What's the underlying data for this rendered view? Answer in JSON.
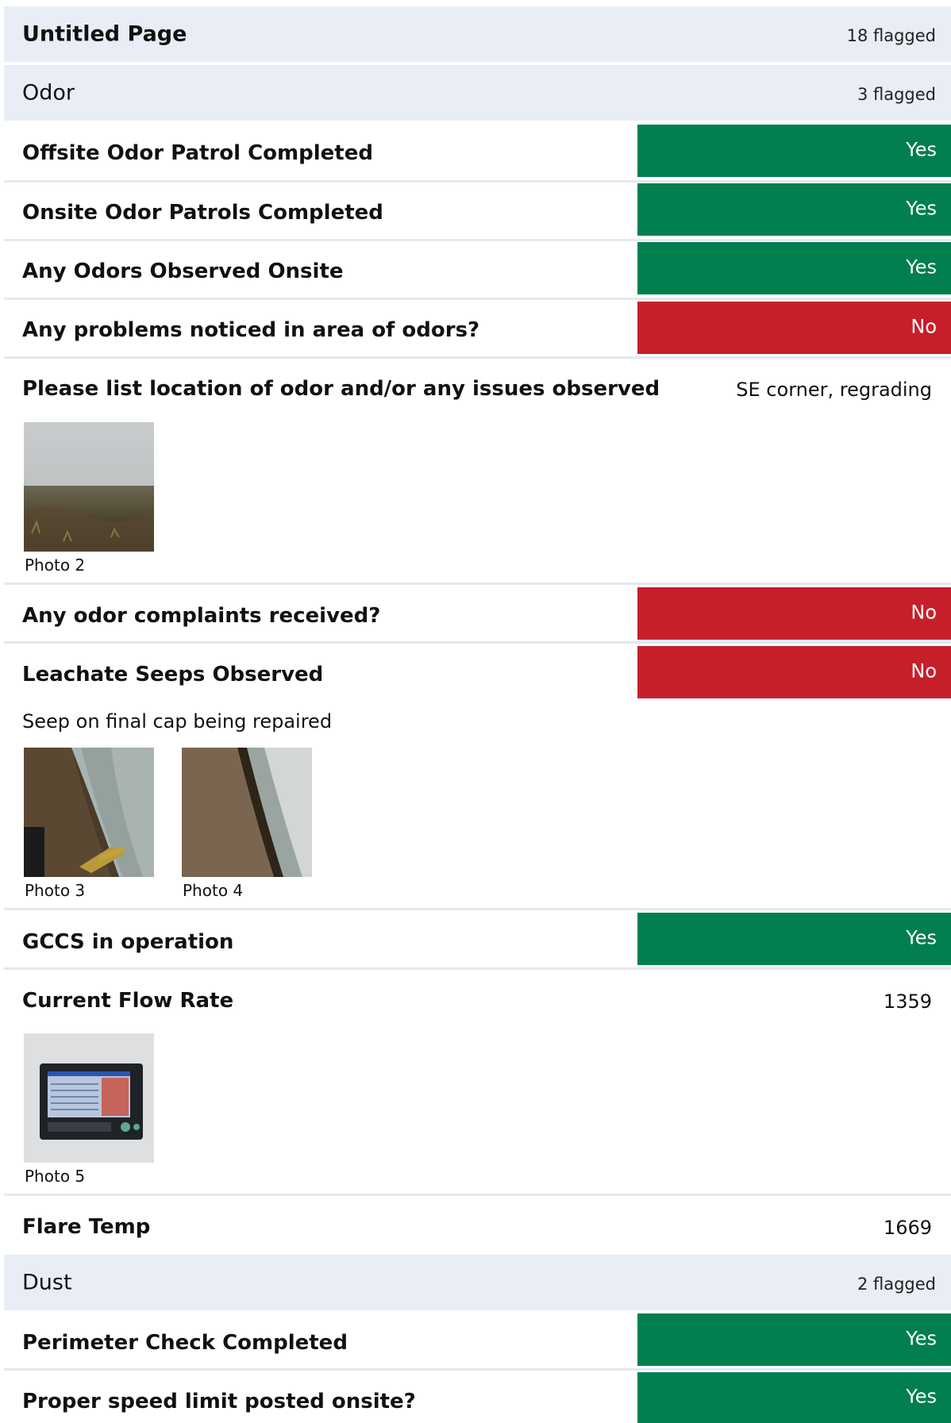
{
  "page": {
    "title": "Untitled Page",
    "flagged": "18 flagged"
  },
  "sections": {
    "odor": {
      "title": "Odor",
      "flagged": "3 flagged",
      "items": {
        "offsite_patrol": {
          "question": "Offsite Odor Patrol Completed",
          "answer": "Yes"
        },
        "onsite_patrols": {
          "question": "Onsite Odor Patrols Completed",
          "answer": "Yes"
        },
        "odors_observed": {
          "question": "Any Odors Observed Onsite",
          "answer": "Yes"
        },
        "problems_noticed": {
          "question": "Any problems noticed in area of odors?",
          "answer": "No"
        },
        "location": {
          "question": "Please list location of odor and/or any issues observed",
          "answer": "SE corner, regrading",
          "photos": [
            "Photo 2"
          ]
        },
        "complaints": {
          "question": "Any odor complaints received?",
          "answer": "No"
        },
        "leachate": {
          "question": "Leachate Seeps Observed",
          "answer": "No",
          "note": "Seep on final cap being repaired",
          "photos": [
            "Photo 3",
            "Photo 4"
          ]
        },
        "gccs": {
          "question": "GCCS in operation",
          "answer": "Yes"
        },
        "flow_rate": {
          "question": "Current Flow Rate",
          "answer": "1359",
          "photos": [
            "Photo 5"
          ]
        },
        "flare_temp": {
          "question": "Flare Temp",
          "answer": "1669"
        }
      }
    },
    "dust": {
      "title": "Dust",
      "flagged": "2 flagged",
      "items": {
        "perimeter": {
          "question": "Perimeter Check Completed",
          "answer": "Yes"
        },
        "speed_limit": {
          "question": "Proper speed limit posted onsite?",
          "answer": "Yes"
        }
      }
    }
  },
  "colors": {
    "yes": "#017f4f",
    "no": "#c61f2a",
    "header_bg": "#e8edf6"
  }
}
